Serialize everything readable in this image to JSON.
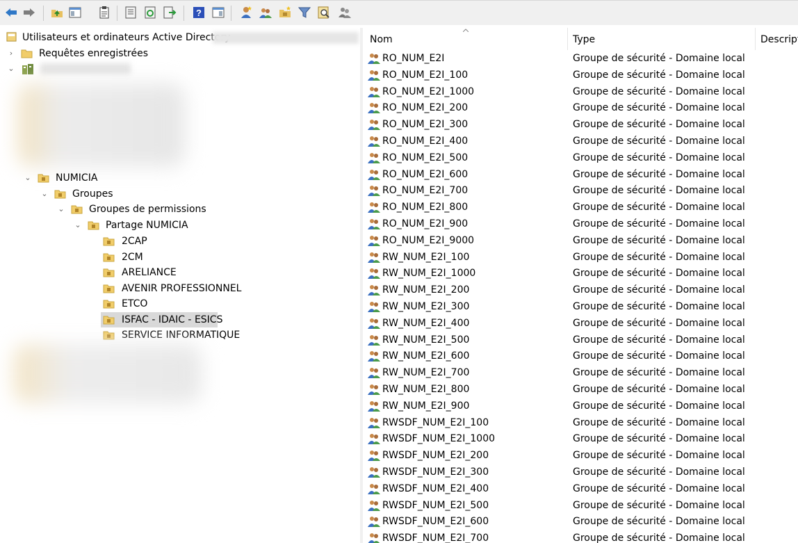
{
  "toolbar": {
    "icons": [
      "back-arrow-icon",
      "forward-arrow-icon",
      "up-folder-icon",
      "show-hide-console-tree-icon",
      "clipboard-icon",
      "properties-icon",
      "refresh-icon",
      "export-list-icon",
      "help-icon",
      "action-pane-icon",
      "new-user-icon",
      "new-group-icon",
      "new-ou-icon",
      "filter-icon",
      "find-icon",
      "add-to-group-icon"
    ]
  },
  "tree": {
    "root_label": "Utilisateurs et ordinateurs Active Directory",
    "saved_queries_label": "Requêtes enregistrées",
    "nodes": [
      {
        "label": "NUMICIA",
        "level": 1
      },
      {
        "label": "Groupes",
        "level": 2
      },
      {
        "label": "Groupes de permissions",
        "level": 3
      },
      {
        "label": "Partage NUMICIA",
        "level": 4
      }
    ],
    "leaves": [
      {
        "label": "2CAP"
      },
      {
        "label": "2CM"
      },
      {
        "label": "ARELIANCE"
      },
      {
        "label": "AVENIR PROFESSIONNEL"
      },
      {
        "label": "ETCO"
      },
      {
        "label": "ISFAC - IDAIC - ESICS",
        "selected": true
      },
      {
        "label": "SERVICE INFORMATIQUE"
      }
    ]
  },
  "list": {
    "columns": [
      "Nom",
      "Type",
      "Descript"
    ],
    "rows": [
      {
        "name": "RO_NUM_E2I",
        "type": "Groupe de sécurité - Domaine local"
      },
      {
        "name": "RO_NUM_E2I_100",
        "type": "Groupe de sécurité - Domaine local"
      },
      {
        "name": "RO_NUM_E2I_1000",
        "type": "Groupe de sécurité - Domaine local"
      },
      {
        "name": "RO_NUM_E2I_200",
        "type": "Groupe de sécurité - Domaine local"
      },
      {
        "name": "RO_NUM_E2I_300",
        "type": "Groupe de sécurité - Domaine local"
      },
      {
        "name": "RO_NUM_E2I_400",
        "type": "Groupe de sécurité - Domaine local"
      },
      {
        "name": "RO_NUM_E2I_500",
        "type": "Groupe de sécurité - Domaine local"
      },
      {
        "name": "RO_NUM_E2I_600",
        "type": "Groupe de sécurité - Domaine local"
      },
      {
        "name": "RO_NUM_E2I_700",
        "type": "Groupe de sécurité - Domaine local"
      },
      {
        "name": "RO_NUM_E2I_800",
        "type": "Groupe de sécurité - Domaine local"
      },
      {
        "name": "RO_NUM_E2I_900",
        "type": "Groupe de sécurité - Domaine local"
      },
      {
        "name": "RO_NUM_E2I_9000",
        "type": "Groupe de sécurité - Domaine local"
      },
      {
        "name": "RW_NUM_E2I_100",
        "type": "Groupe de sécurité - Domaine local"
      },
      {
        "name": "RW_NUM_E2I_1000",
        "type": "Groupe de sécurité - Domaine local"
      },
      {
        "name": "RW_NUM_E2I_200",
        "type": "Groupe de sécurité - Domaine local"
      },
      {
        "name": "RW_NUM_E2I_300",
        "type": "Groupe de sécurité - Domaine local"
      },
      {
        "name": "RW_NUM_E2I_400",
        "type": "Groupe de sécurité - Domaine local"
      },
      {
        "name": "RW_NUM_E2I_500",
        "type": "Groupe de sécurité - Domaine local"
      },
      {
        "name": "RW_NUM_E2I_600",
        "type": "Groupe de sécurité - Domaine local"
      },
      {
        "name": "RW_NUM_E2I_700",
        "type": "Groupe de sécurité - Domaine local"
      },
      {
        "name": "RW_NUM_E2I_800",
        "type": "Groupe de sécurité - Domaine local"
      },
      {
        "name": "RW_NUM_E2I_900",
        "type": "Groupe de sécurité - Domaine local"
      },
      {
        "name": "RWSDF_NUM_E2I_100",
        "type": "Groupe de sécurité - Domaine local"
      },
      {
        "name": "RWSDF_NUM_E2I_1000",
        "type": "Groupe de sécurité - Domaine local"
      },
      {
        "name": "RWSDF_NUM_E2I_200",
        "type": "Groupe de sécurité - Domaine local"
      },
      {
        "name": "RWSDF_NUM_E2I_300",
        "type": "Groupe de sécurité - Domaine local"
      },
      {
        "name": "RWSDF_NUM_E2I_400",
        "type": "Groupe de sécurité - Domaine local"
      },
      {
        "name": "RWSDF_NUM_E2I_500",
        "type": "Groupe de sécurité - Domaine local"
      },
      {
        "name": "RWSDF_NUM_E2I_600",
        "type": "Groupe de sécurité - Domaine local"
      },
      {
        "name": "RWSDF_NUM_E2I_700",
        "type": "Groupe de sécurité - Domaine local"
      }
    ]
  }
}
